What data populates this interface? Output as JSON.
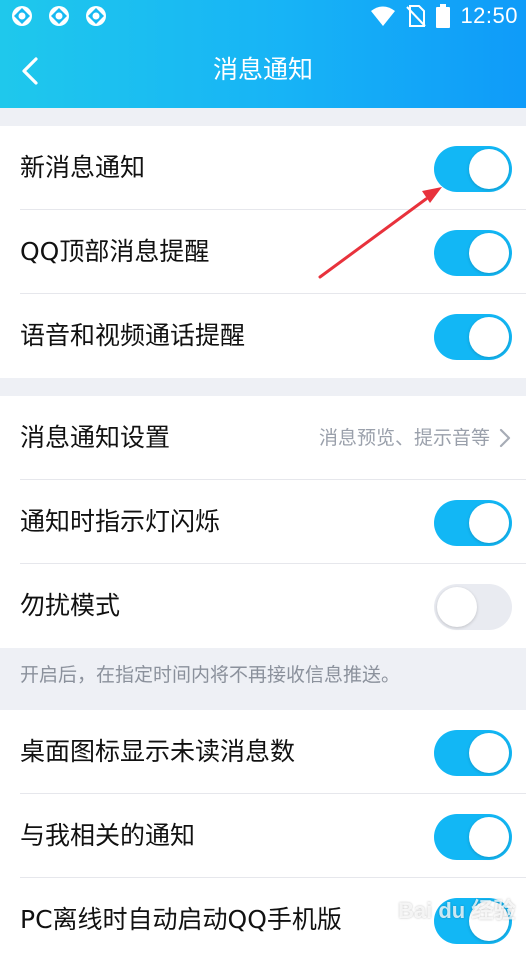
{
  "status_bar": {
    "time": "12:50",
    "icons": [
      "app-notification-icon",
      "app-notification-icon",
      "app-notification-icon",
      "wifi-icon",
      "no-sim-icon",
      "battery-icon"
    ]
  },
  "header": {
    "title": "消息通知",
    "back_icon": "chevron-left-icon"
  },
  "colors": {
    "header_start": "#1fc8ec",
    "header_end": "#0f9bf9",
    "toggle_on": "#12b7f5",
    "toggle_off": "#e9ebf1",
    "annotation_arrow": "#e8323c"
  },
  "section1": {
    "items": [
      {
        "label": "新消息通知",
        "on": true
      },
      {
        "label": "QQ顶部消息提醒",
        "on": true
      },
      {
        "label": "语音和视频通话提醒",
        "on": true
      }
    ]
  },
  "section2": {
    "settings_item": {
      "label": "消息通知设置",
      "value": "消息预览、提示音等"
    },
    "items": [
      {
        "label": "通知时指示灯闪烁",
        "on": true
      },
      {
        "label": "勿扰模式",
        "on": false
      }
    ],
    "hint": "开启后，在指定时间内将不再接收信息推送。"
  },
  "section3": {
    "items": [
      {
        "label": "桌面图标显示未读消息数",
        "on": true
      },
      {
        "label": "与我相关的通知",
        "on": true
      },
      {
        "label": "PC离线时自动启动QQ手机版",
        "on": true
      }
    ]
  },
  "watermark": "Bai du 经验"
}
